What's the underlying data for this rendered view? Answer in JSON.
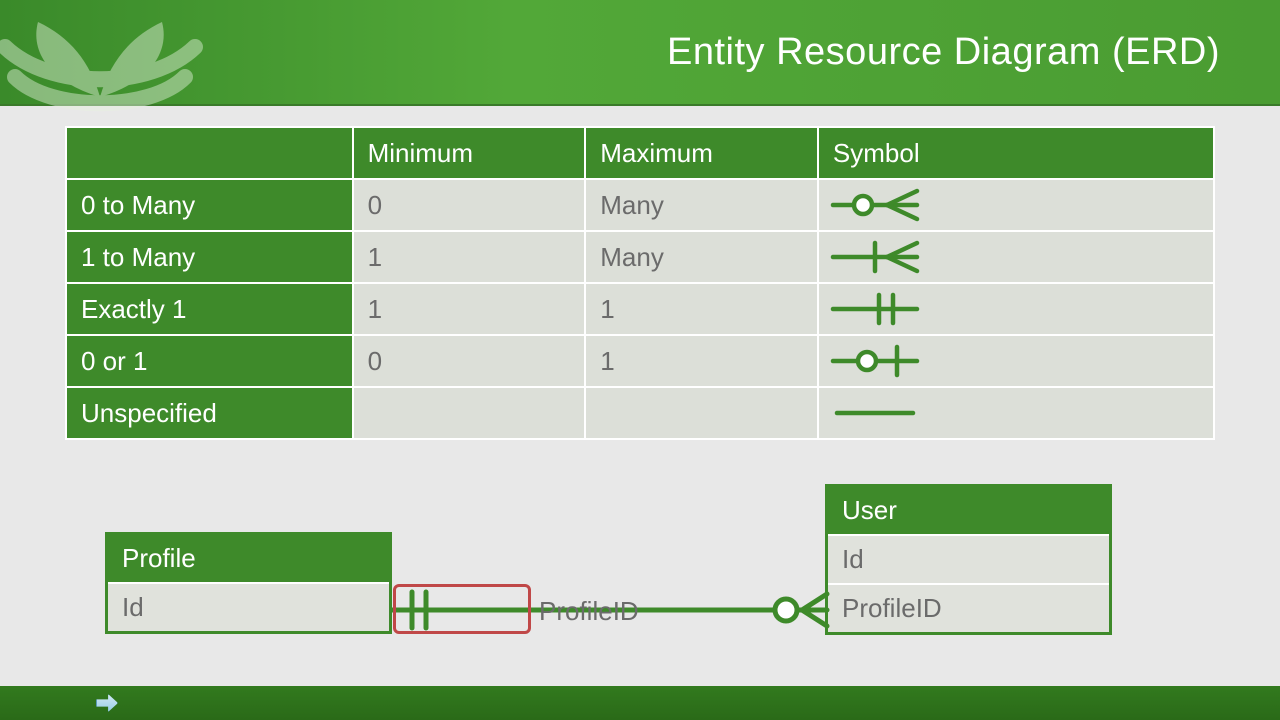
{
  "header": {
    "title": "Entity Resource Diagram (ERD)"
  },
  "table": {
    "headers": [
      "",
      "Minimum",
      "Maximum",
      "Symbol"
    ],
    "rows": [
      {
        "label": "0 to Many",
        "min": "0",
        "max": "Many",
        "symbol": "zero-to-many"
      },
      {
        "label": "1 to Many",
        "min": "1",
        "max": "Many",
        "symbol": "one-to-many"
      },
      {
        "label": "Exactly 1",
        "min": "1",
        "max": "1",
        "symbol": "exactly-one"
      },
      {
        "label": "0 or 1",
        "min": "0",
        "max": "1",
        "symbol": "zero-or-one"
      },
      {
        "label": "Unspecified",
        "min": "",
        "max": "",
        "symbol": "unspecified"
      }
    ]
  },
  "erd": {
    "entities": {
      "profile": {
        "name": "Profile",
        "attrs": [
          "Id"
        ]
      },
      "user": {
        "name": "User",
        "attrs": [
          "Id",
          "ProfileID"
        ]
      }
    },
    "relationship": {
      "from": "Profile",
      "from_cardinality": "exactly-one",
      "to": "User",
      "to_cardinality": "zero-to-many",
      "label": "ProfileID",
      "highlighted_end": "from"
    }
  },
  "colors": {
    "brand_green": "#3e8a2a",
    "header_gradient": [
      "#3a8a2a",
      "#52a838"
    ],
    "highlight_red": "#c04848"
  }
}
